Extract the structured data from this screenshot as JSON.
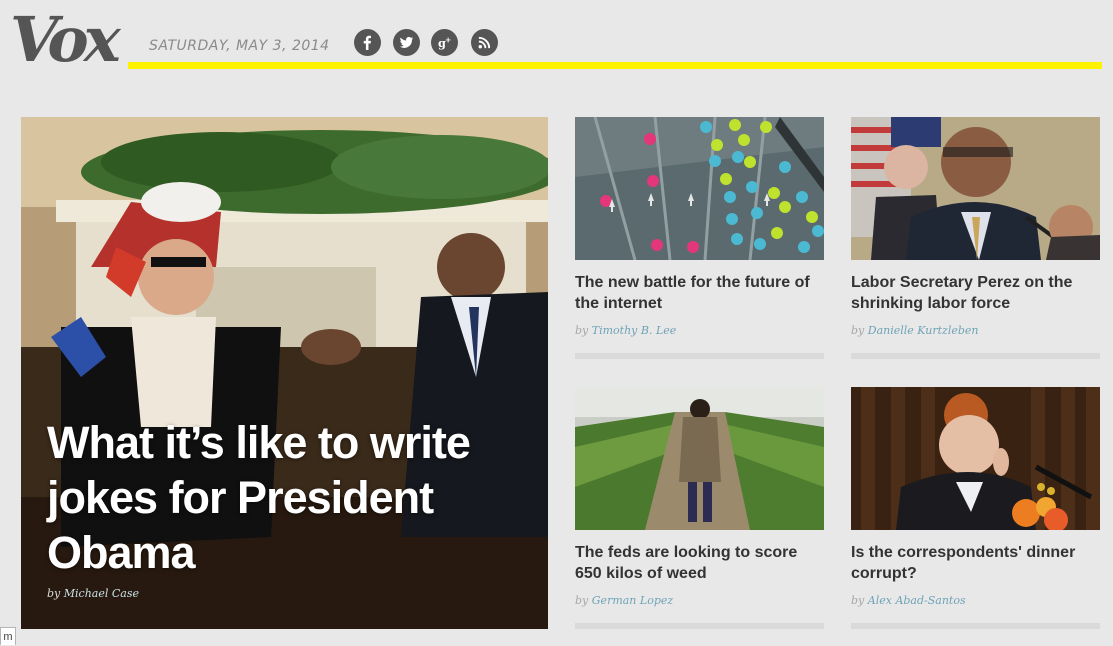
{
  "header": {
    "logo": "Vox",
    "date": "SATURDAY, MAY 3, 2014",
    "social": [
      "facebook-icon",
      "twitter-icon",
      "google-plus-icon",
      "rss-icon"
    ],
    "accent_color": "#fff200"
  },
  "hero": {
    "title": "What it’s like to write jokes for President Obama",
    "by": "by",
    "author": "Michael Case"
  },
  "cards": [
    {
      "title": "The new battle for the future of the internet",
      "by": "by",
      "author": "Timothy B. Lee"
    },
    {
      "title": "Labor Secretary Perez on the shrinking labor force",
      "by": "by",
      "author": "Danielle Kurtzleben"
    },
    {
      "title": "The feds are looking to score 650 kilos of weed",
      "by": "by",
      "author": "German Lopez"
    },
    {
      "title": "Is the correspondents' dinner corrupt?",
      "by": "by",
      "author": "Alex Abad-Santos"
    }
  ],
  "corner_tab": "m"
}
